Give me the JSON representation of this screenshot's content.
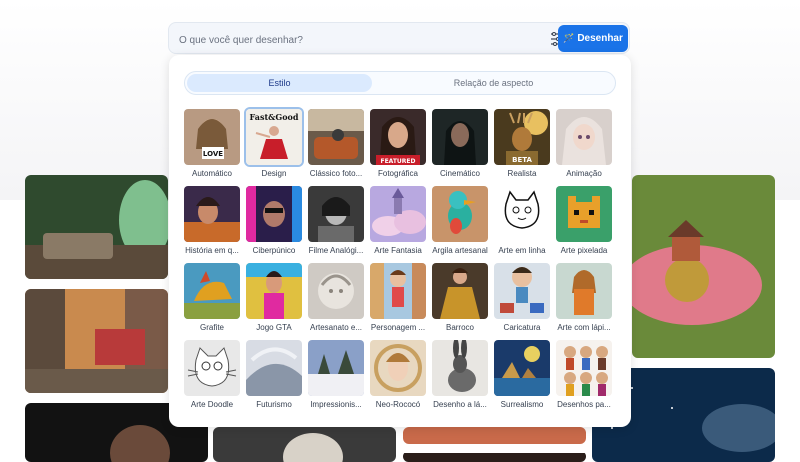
{
  "search": {
    "placeholder": "O que você quer desenhar?",
    "button_label": "Desenhar"
  },
  "tabs": [
    {
      "label": "Estilo",
      "active": true
    },
    {
      "label": "Relação de aspecto",
      "active": false
    }
  ],
  "styles": [
    {
      "label": "Automático",
      "thumb_text": "LOVE",
      "selected": false
    },
    {
      "label": "Design",
      "thumb_text": "Fast&Good",
      "selected": true
    },
    {
      "label": "Clássico foto...",
      "selected": false
    },
    {
      "label": "Fotográfica",
      "thumb_text": "FEATURED",
      "selected": false
    },
    {
      "label": "Cinemático",
      "selected": false
    },
    {
      "label": "Realista",
      "thumb_text": "BETA",
      "selected": false
    },
    {
      "label": "Animação",
      "selected": false
    },
    {
      "label": "História em q...",
      "selected": false
    },
    {
      "label": "Ciberpúnico",
      "selected": false
    },
    {
      "label": "Filme Analógi...",
      "selected": false
    },
    {
      "label": "Arte Fantasia",
      "selected": false
    },
    {
      "label": "Argila artesanal",
      "selected": false
    },
    {
      "label": "Arte em linha",
      "selected": false
    },
    {
      "label": "Arte pixelada",
      "selected": false
    },
    {
      "label": "Grafite",
      "selected": false
    },
    {
      "label": "Jogo GTA",
      "selected": false
    },
    {
      "label": "Artesanato e...",
      "selected": false
    },
    {
      "label": "Personagem ...",
      "selected": false
    },
    {
      "label": "Barroco",
      "selected": false
    },
    {
      "label": "Caricatura",
      "selected": false
    },
    {
      "label": "Arte com lápi...",
      "selected": false
    },
    {
      "label": "Arte Doodle",
      "selected": false
    },
    {
      "label": "Futurismo",
      "selected": false
    },
    {
      "label": "Impressionis...",
      "selected": false
    },
    {
      "label": "Neo-Rococó",
      "selected": false
    },
    {
      "label": "Desenho a lá...",
      "selected": false
    },
    {
      "label": "Surrealismo",
      "selected": false
    },
    {
      "label": "Desenhos pa...",
      "selected": false
    }
  ],
  "colors": {
    "accent": "#1a73e8",
    "tab_active_bg": "#dbeafe",
    "panel_bg": "#ffffff"
  },
  "icons": {
    "filter": "filter-sliders-icon",
    "wand": "magic-wand-icon"
  }
}
